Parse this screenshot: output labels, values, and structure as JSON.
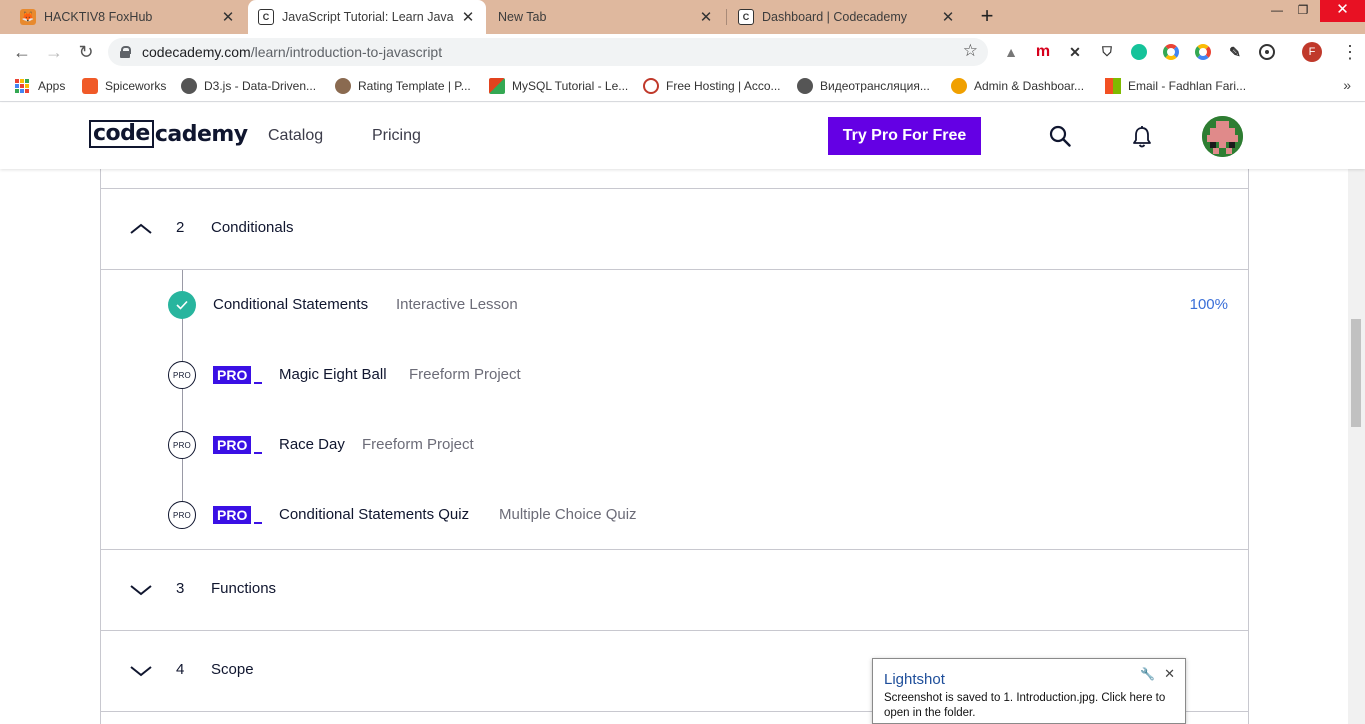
{
  "browser": {
    "tabs": [
      {
        "title": "HACKTIV8 FoxHub",
        "favicon": "fox-icon",
        "active": false
      },
      {
        "title": "JavaScript Tutorial: Learn JavaScr",
        "favicon": "codecademy-icon",
        "active": true
      },
      {
        "title": "New Tab",
        "favicon": "",
        "active": false
      },
      {
        "title": "Dashboard | Codecademy",
        "favicon": "codecademy-icon",
        "active": false
      }
    ],
    "new_tab_glyph": "+",
    "url_domain": "codecademy.com",
    "url_path": "/learn/introduction-to-javascript",
    "profile_initial": "F",
    "extension_m": "m"
  },
  "bookmarks": [
    {
      "label": "Apps"
    },
    {
      "label": "Spiceworks",
      "color": "#f05a28"
    },
    {
      "label": "D3.js - Data-Driven...",
      "color": "#555555"
    },
    {
      "label": "Rating Template | P...",
      "color": "#8a6a50"
    },
    {
      "label": "MySQL Tutorial - Le...",
      "color": "#e2431e"
    },
    {
      "label": "Free Hosting | Acco...",
      "color": "#c0392b"
    },
    {
      "label": "Видеотрансляция...",
      "color": "#555555"
    },
    {
      "label": "Admin & Dashboar...",
      "color": "#f0a000"
    },
    {
      "label": "Email - Fadhlan Fari...",
      "color": "#0078d4"
    }
  ],
  "header": {
    "logo_boxed": "code",
    "logo_rest": "cademy",
    "nav": [
      "Catalog",
      "Pricing"
    ],
    "cta": "Try Pro For Free"
  },
  "syllabus": {
    "modules": [
      {
        "number": "2",
        "title": "Conditionals",
        "expanded": true
      },
      {
        "number": "3",
        "title": "Functions",
        "expanded": false
      },
      {
        "number": "4",
        "title": "Scope",
        "expanded": false
      }
    ],
    "lessons": [
      {
        "title": "Conditional Statements",
        "type": "Interactive Lesson",
        "progress": "100%",
        "completed": true
      },
      {
        "title": "Magic Eight Ball",
        "type": "Freeform Project",
        "pro": true,
        "badge": "PRO",
        "dot": "PRO"
      },
      {
        "title": "Race Day",
        "type": "Freeform Project",
        "pro": true,
        "badge": "PRO",
        "dot": "PRO"
      },
      {
        "title": "Conditional Statements Quiz",
        "type": "Multiple Choice Quiz",
        "pro": true,
        "badge": "PRO",
        "dot": "PRO"
      }
    ]
  },
  "lightshot": {
    "title": "Lightshot",
    "message": "Screenshot is saved to 1. Introduction.jpg. Click here to open in the folder."
  },
  "colors": {
    "cta": "#6400e4",
    "pro_badge": "#3a10e5",
    "complete": "#28b59e",
    "progress_text": "#3a6fd8"
  }
}
